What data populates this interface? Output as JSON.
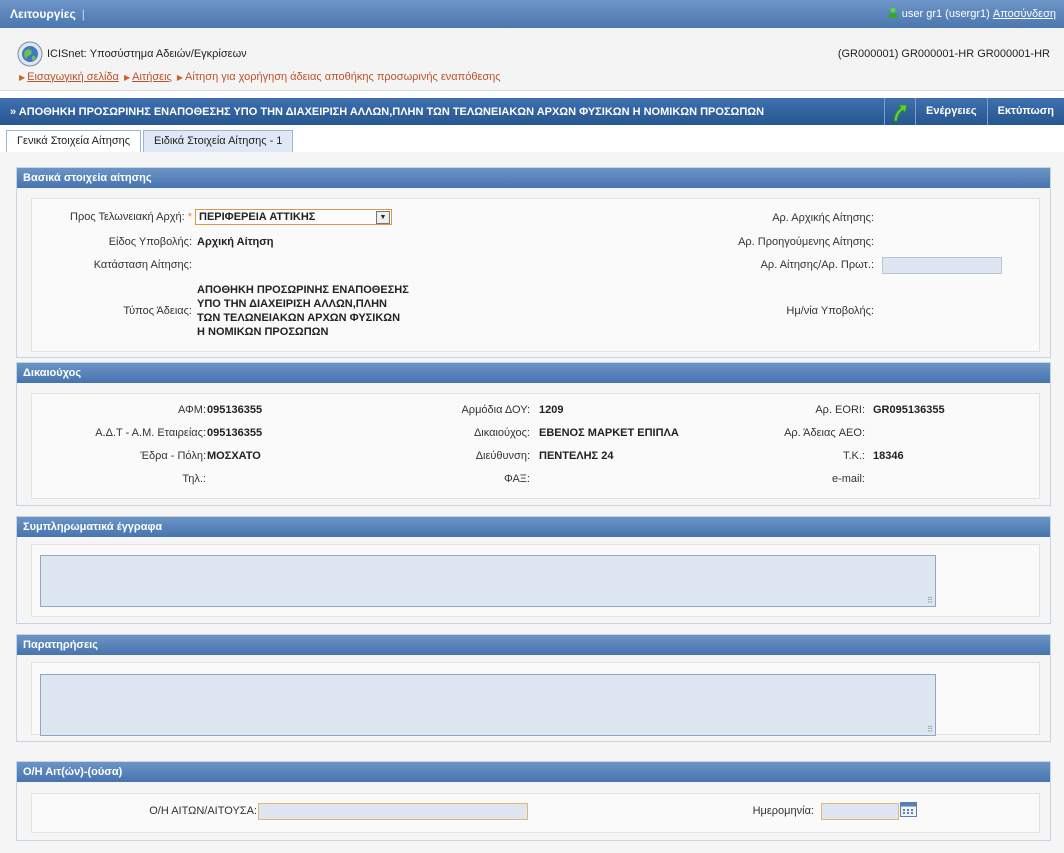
{
  "topbar": {
    "menu_label": "Λειτουργίες",
    "menu_sep": "|",
    "user_label": "user gr1 (usergr1)",
    "logout_label": "Αποσύνδεση"
  },
  "header": {
    "app_title": "ICISnet: Υποσύστημα Αδειών/Εγκρίσεων",
    "codes": "(GR000001) GR000001-HR GR000001-HR",
    "breadcrumb": {
      "home": "Εισαγωγική σελίδα",
      "requests": "Αιτήσεις",
      "current": "Αίτηση για χορήγηση άδειας αποθήκης προσωρινής εναπόθεσης"
    }
  },
  "titlebar": {
    "title": "» ΑΠΟΘΗΚΗ ΠΡΟΣΩΡΙΝΗΣ ΕΝΑΠΟΘΕΣΗΣ ΥΠΟ ΤΗΝ ΔΙΑΧΕΙΡΙΣΗ ΑΛΛΩΝ,ΠΛΗΝ ΤΩΝ ΤΕΛΩΝΕΙΑΚΩΝ ΑΡΧΩΝ ΦΥΣΙΚΩΝ Η ΝΟΜΙΚΩΝ ΠΡΟΣΩΠΩΝ",
    "actions_label": "Ενέργειες",
    "print_label": "Εκτύπωση"
  },
  "tabs": [
    {
      "label": "Γενικά Στοιχεία Αίτησης"
    },
    {
      "label": "Ειδικά Στοιχεία Αίτησης - 1"
    }
  ],
  "basic": {
    "header": "Βασικά στοιχεία αίτησης",
    "authority_label": "Προς Τελωνειακή Αρχή:",
    "required_mark": "*",
    "authority_value": "ΠΕΡΙΦΕΡΕΙΑ ΑΤΤΙΚΗΣ",
    "submission_type_label": "Είδος Υποβολής:",
    "submission_type_value": "Αρχική Αίτηση",
    "status_label": "Κατάσταση Αίτησης:",
    "license_type_label": "Τύπος Άδειας:",
    "license_type_lines": [
      "ΑΠΟΘΗΚΗ ΠΡΟΣΩΡΙΝΗΣ ΕΝΑΠΟΘΕΣΗΣ",
      "ΥΠΟ ΤΗΝ ΔΙΑΧΕΙΡΙΣΗ ΑΛΛΩΝ,ΠΛΗΝ",
      "ΤΩΝ ΤΕΛΩΝΕΙΑΚΩΝ ΑΡΧΩΝ ΦΥΣΙΚΩΝ",
      "Η ΝΟΜΙΚΩΝ ΠΡΟΣΩΠΩΝ"
    ],
    "initial_no_label": "Αρ. Αρχικής Αίτησης:",
    "previous_no_label": "Αρ. Προηγούμενης Αίτησης:",
    "protocol_no_label": "Αρ. Αίτησης/Αρ. Πρωτ.:",
    "submission_date_label": "Ημ/νία Υποβολής:"
  },
  "beneficiary": {
    "header": "Δικαιούχος",
    "afm_label": "ΑΦΜ:",
    "afm_value": "095136355",
    "adt_label": "Α.Δ.Τ - Α.Μ. Εταιρείας:",
    "adt_value": "095136355",
    "city_label": "Έδρα - Πόλη:",
    "city_value": "ΜΟΣΧΑΤΟ",
    "phone_label": "Τηλ.:",
    "doy_label": "Αρμόδια ΔΟΥ:",
    "doy_value": "1209",
    "holder_label": "Δικαιούχος:",
    "holder_value": "ΕΒΕΝΟΣ ΜΑΡΚΕΤ ΕΠΙΠΛΑ",
    "address_label": "Διεύθυνση:",
    "address_value": "ΠΕΝΤΕΛΗΣ 24",
    "fax_label": "ΦΑΞ:",
    "eori_label": "Αρ. EORI:",
    "eori_value": "GR095136355",
    "aeo_label": "Αρ. Άδειας AEO:",
    "zip_label": "Τ.Κ.:",
    "zip_value": "18346",
    "email_label": "e-mail:"
  },
  "docs": {
    "header": "Συμπληρωματικά έγγραφα"
  },
  "remarks": {
    "header": "Παρατηρήσεις"
  },
  "applicant": {
    "header": "Ο/Η Αιτ(ών)-(ούσα)",
    "name_label": "Ο/Η ΑΙΤΩΝ/ΑΙΤΟΥΣΑ:",
    "date_label": "Ημερομηνία:"
  },
  "icons": {
    "logo": "globe-icon",
    "user": "user-icon",
    "go": "green-arrow-icon",
    "calendar": "calendar-icon"
  },
  "colors": {
    "topbar": "#4b77b0",
    "titlebar": "#27578f",
    "section_header": "#4774af",
    "breadcrumb": "#c0502a",
    "required": "#e09020"
  }
}
